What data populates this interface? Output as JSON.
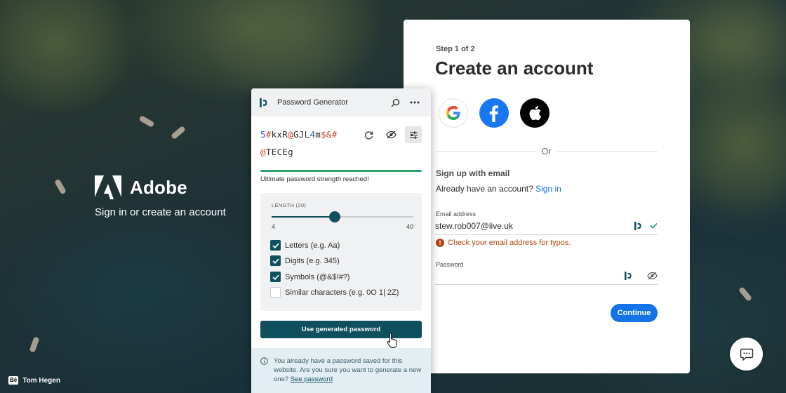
{
  "brand": {
    "name": "Adobe",
    "tagline": "Sign in or create an account",
    "photo_credit": "Tom Hegen",
    "behance_badge": "Bē"
  },
  "signup": {
    "step": "Step 1 of 2",
    "title": "Create an account",
    "social_buttons": [
      "google",
      "facebook",
      "apple"
    ],
    "or_text": "Or",
    "signup_with_email": "Sign up with email",
    "already_text": "Already have an account?",
    "sign_in_link": "Sign in",
    "email_label": "Email address",
    "email_value": "stew.rob007@live.uk",
    "email_warning": "Check your email address for typos.",
    "password_label": "Password",
    "password_value": "",
    "continue_label": "Continue"
  },
  "generator": {
    "title": "Password Generator",
    "password_line1": [
      {
        "t": "5",
        "k": "num"
      },
      {
        "t": "#",
        "k": "sym"
      },
      {
        "t": "kxR",
        "k": "txt"
      },
      {
        "t": "@",
        "k": "sym"
      },
      {
        "t": "GJL",
        "k": "txt"
      },
      {
        "t": "4",
        "k": "num"
      },
      {
        "t": "m",
        "k": "txt"
      },
      {
        "t": "$&#",
        "k": "sym"
      }
    ],
    "password_line2": [
      {
        "t": "@",
        "k": "sym"
      },
      {
        "t": "TECEg",
        "k": "txt"
      }
    ],
    "strength_text": "Ultimate password strength reached!",
    "length_label": "LENGTH (20)",
    "length_value": 20,
    "length_min": "4",
    "length_max": "40",
    "options": [
      {
        "label": "Letters (e.g. Aa)",
        "checked": true
      },
      {
        "label": "Digits (e.g. 345)",
        "checked": true
      },
      {
        "label": "Symbols (@&$!#?)",
        "checked": true
      },
      {
        "label": "Similar characters (e.g. 0O 1| 2Z)",
        "checked": false
      }
    ],
    "use_button": "Use generated password",
    "info_text": "You already have a password saved for this website. Are you sure you want to generate a new one?",
    "info_link": "See password"
  },
  "colors": {
    "adobe_blue": "#1473e6",
    "generator_teal": "#0f4f5e",
    "strength_green": "#2fa36b",
    "warning": "#b3440f"
  },
  "icons": {
    "generator": [
      "dashlane-logo-icon",
      "search-icon",
      "more-icon",
      "refresh-icon",
      "eye-off-icon",
      "settings-sliders-icon",
      "check-icon",
      "info-icon",
      "hand-cursor-icon"
    ],
    "signup": [
      "google-icon",
      "facebook-icon",
      "apple-icon",
      "dashlane-field-icon",
      "checkmark-icon",
      "warning-icon",
      "eye-off-icon"
    ],
    "page": [
      "adobe-logo-icon",
      "chat-icon"
    ]
  }
}
